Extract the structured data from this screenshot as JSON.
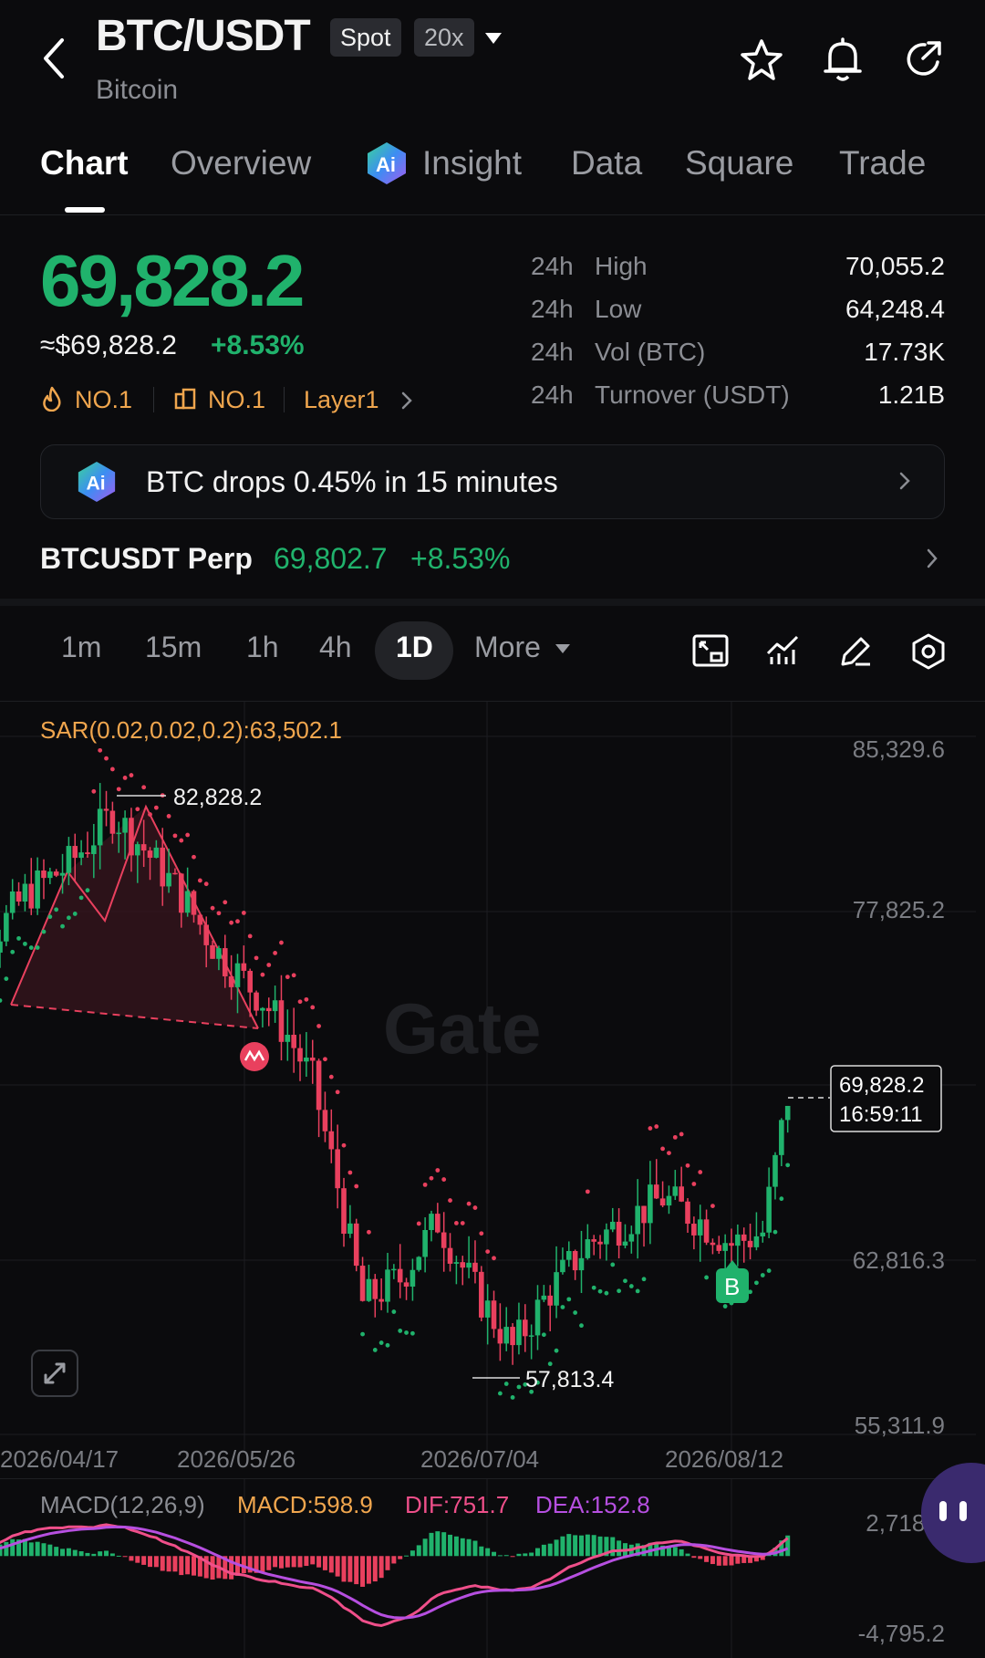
{
  "header": {
    "title": "BTC/USDT",
    "badge_spot": "Spot",
    "badge_leverage": "20x",
    "subtitle": "Bitcoin"
  },
  "tabs": [
    {
      "label": "Chart"
    },
    {
      "label": "Overview"
    },
    {
      "label": "Insight"
    },
    {
      "label": "Data"
    },
    {
      "label": "Square"
    },
    {
      "label": "Trade"
    }
  ],
  "ticker": {
    "price": "69,828.2",
    "usd_price": "≈$69,828.2",
    "change": "+8.53%",
    "rank1": "NO.1",
    "rank2": "NO.1",
    "tag": "Layer1",
    "stats": [
      {
        "prefix": "24h",
        "label": "High",
        "value": "70,055.2"
      },
      {
        "prefix": "24h",
        "label": "Low",
        "value": "64,248.4"
      },
      {
        "prefix": "24h",
        "label": "Vol (BTC)",
        "value": "17.73K"
      },
      {
        "prefix": "24h",
        "label": "Turnover (USDT)",
        "value": "1.21B"
      }
    ]
  },
  "alert": {
    "text": "BTC drops 0.45% in 15 minutes"
  },
  "perp": {
    "name": "BTCUSDT Perp",
    "price": "69,802.7",
    "change": "+8.53%"
  },
  "timeframes": {
    "items": [
      "1m",
      "15m",
      "1h",
      "4h",
      "1D"
    ],
    "active": "1D",
    "more_label": "More"
  },
  "colors": {
    "up": "#20b26c",
    "down": "#e9405e",
    "sar": "#f0a64e",
    "macd": "#f0a64e",
    "dif": "#ef4f8a",
    "dea": "#b64fe0",
    "background": "#0b0b0d"
  },
  "icons": {
    "back": "chevron-left-icon",
    "star": "star-icon",
    "bell": "bell-icon",
    "share": "share-icon",
    "fullscreen": "expand-icon"
  },
  "chart_data": {
    "type": "candlestick",
    "indicator_label": "SAR(0.02,0.02,0.2):63,502.1",
    "y_ticks": [
      "85,329.6",
      "77,825.2",
      "62,816.3",
      "55,311.9"
    ],
    "x_ticks": [
      "2026/04/17",
      "2026/05/26",
      "2026/07/04",
      "2026/08/12"
    ],
    "ylim": [
      55311.9,
      85329.6
    ],
    "high_marker": "82,828.2",
    "low_marker": "57,813.4",
    "last_price": "69,828.2",
    "countdown": "16:59:11",
    "watermark": "Gate",
    "signal_marker": "B",
    "close_trace": [
      [
        "2026/04/08",
        73200
      ],
      [
        "2026/04/14",
        76000
      ],
      [
        "2026/04/21",
        78500
      ],
      [
        "2026/04/28",
        79800
      ],
      [
        "2026/05/05",
        82000
      ],
      [
        "2026/05/10",
        80500
      ],
      [
        "2026/05/16",
        78500
      ],
      [
        "2026/05/22",
        76000
      ],
      [
        "2026/05/29",
        74000
      ],
      [
        "2026/06/02",
        72500
      ],
      [
        "2026/06/06",
        70500
      ],
      [
        "2026/06/10",
        66000
      ],
      [
        "2026/06/14",
        61000
      ],
      [
        "2026/06/20",
        62000
      ],
      [
        "2026/06/26",
        64500
      ],
      [
        "2026/07/02",
        61500
      ],
      [
        "2026/07/08",
        59000
      ],
      [
        "2026/07/14",
        61500
      ],
      [
        "2026/07/20",
        63500
      ],
      [
        "2026/07/26",
        64500
      ],
      [
        "2026/08/01",
        65500
      ],
      [
        "2026/08/07",
        64500
      ],
      [
        "2026/08/12",
        63500
      ],
      [
        "2026/08/17",
        64000
      ],
      [
        "2026/08/21",
        69828.2
      ]
    ],
    "macd": {
      "label": "MACD(12,26,9)",
      "macd": "MACD:598.9",
      "dif": "DIF:751.7",
      "dea": "DEA:152.8",
      "y_ticks": [
        "2,718.8",
        "-4,795.2"
      ]
    }
  }
}
